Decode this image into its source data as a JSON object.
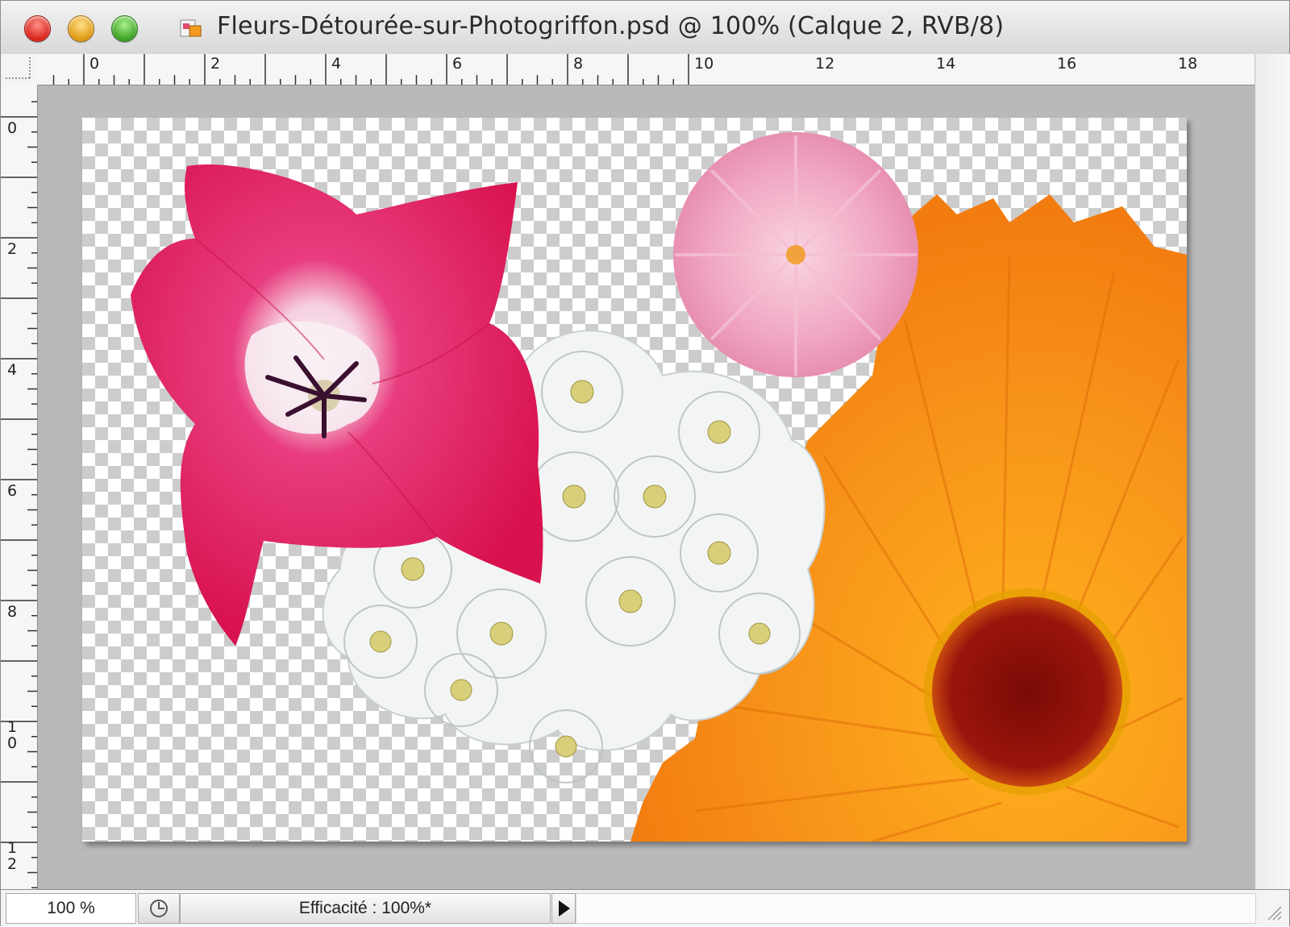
{
  "window": {
    "title": "Fleurs-Détourée-sur-Photogriffon.psd @ 100% (Calque 2, RVB/8)"
  },
  "ruler": {
    "top_labels": [
      "0",
      "2",
      "4",
      "6",
      "8",
      "10",
      "12",
      "14",
      "16",
      "18"
    ],
    "left_labels": [
      "0",
      "2",
      "4",
      "6",
      "8",
      "1\n0",
      "1\n2"
    ],
    "unit": "cm"
  },
  "canvas": {
    "background": "transparent-checkerboard",
    "layers_depicted": [
      "pink tulip",
      "white blossom cluster",
      "pink daisy",
      "orange calendula"
    ]
  },
  "statusbar": {
    "zoom_value": "100 %",
    "info_text": "Efficacité : 100%*"
  },
  "icons": {
    "close": "close-traffic-light",
    "minimize": "minimize-traffic-light",
    "zoom": "zoom-traffic-light",
    "document": "psd-document-icon",
    "status": "status-menu-icon",
    "arrow": "play-arrow-icon",
    "resize": "resize-grip-icon"
  },
  "colors": {
    "canvas_area": "#b9b9b9",
    "tulip": "#e0185e",
    "calendula": "#f58c10",
    "daisy": "#f0a0c0",
    "blossom": "#f2f4f4"
  }
}
